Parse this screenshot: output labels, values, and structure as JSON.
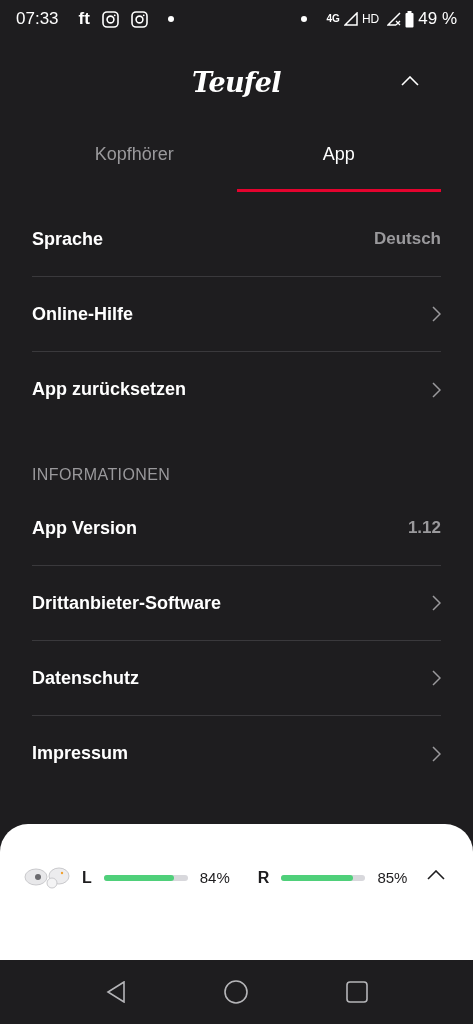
{
  "status_bar": {
    "time": "07:33",
    "app_label": "ft",
    "network": "4G",
    "hd": "HD",
    "battery": "49 %"
  },
  "header": {
    "logo": "Teufel"
  },
  "tabs": [
    {
      "label": "Kopfhörer",
      "selected": false
    },
    {
      "label": "App",
      "selected": true
    }
  ],
  "sections": [
    {
      "items": [
        {
          "kind": "value",
          "label": "Sprache",
          "value": "Deutsch"
        },
        {
          "kind": "link",
          "label": "Online-Hilfe"
        },
        {
          "kind": "link",
          "label": "App zurücksetzen"
        }
      ]
    },
    {
      "header": "INFORMATIONEN",
      "items": [
        {
          "kind": "value",
          "label": "App Version",
          "value": "1.12"
        },
        {
          "kind": "link",
          "label": "Drittanbieter-Software"
        },
        {
          "kind": "link",
          "label": "Datenschutz"
        },
        {
          "kind": "link",
          "label": "Impressum"
        }
      ]
    }
  ],
  "battery_panel": {
    "earbuds": [
      {
        "side": "L",
        "level": 0.84,
        "reading": "84%"
      },
      {
        "side": "R",
        "level": 0.85,
        "reading": "85%"
      }
    ]
  }
}
